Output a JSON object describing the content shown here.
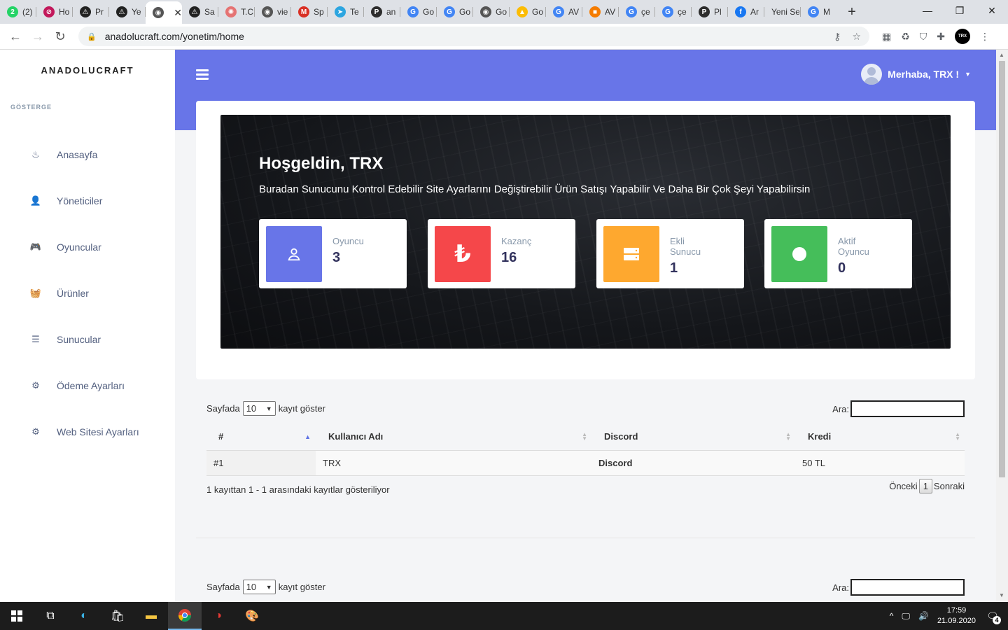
{
  "browser": {
    "tabs": [
      {
        "label": "(2)",
        "icon": "whatsapp-icon",
        "color": "#25d366",
        "glyph": "2"
      },
      {
        "label": "Ho",
        "icon": "site-icon",
        "color": "#c2185b",
        "glyph": "⊘"
      },
      {
        "label": "Pr",
        "icon": "triangle-logo-icon",
        "color": "#222222",
        "glyph": "⚠"
      },
      {
        "label": "Ye",
        "icon": "triangle-logo-icon",
        "color": "#222222",
        "glyph": "⚠"
      },
      {
        "label": "",
        "icon": "globe-icon",
        "color": "#555555",
        "glyph": "◉",
        "active": true
      },
      {
        "label": "Sa",
        "icon": "triangle-logo-icon",
        "color": "#222222",
        "glyph": "⚠"
      },
      {
        "label": "T.C",
        "icon": "government-seal-icon",
        "color": "#e57373",
        "glyph": "✺"
      },
      {
        "label": "vie",
        "icon": "globe-icon",
        "color": "#555555",
        "glyph": "◉"
      },
      {
        "label": "Sp",
        "icon": "gmail-icon",
        "color": "#d93025",
        "glyph": "M"
      },
      {
        "label": "Te",
        "icon": "telegram-icon",
        "color": "#2ca5e0",
        "glyph": "➤"
      },
      {
        "label": "an",
        "icon": "p-logo-icon",
        "color": "#2d2d2d",
        "glyph": "P"
      },
      {
        "label": "Go",
        "icon": "google-icon",
        "color": "#4285f4",
        "glyph": "G"
      },
      {
        "label": "Go",
        "icon": "google-icon",
        "color": "#4285f4",
        "glyph": "G"
      },
      {
        "label": "Go",
        "icon": "globe-icon",
        "color": "#555555",
        "glyph": "◉"
      },
      {
        "label": "Go",
        "icon": "google-ads-icon",
        "color": "#fbbc04",
        "glyph": "▲"
      },
      {
        "label": "AV",
        "icon": "google-icon",
        "color": "#4285f4",
        "glyph": "G"
      },
      {
        "label": "AV",
        "icon": "cube-icon",
        "color": "#f57c00",
        "glyph": "■"
      },
      {
        "label": "çe",
        "icon": "google-icon",
        "color": "#4285f4",
        "glyph": "G"
      },
      {
        "label": "çe",
        "icon": "google-icon",
        "color": "#4285f4",
        "glyph": "G"
      },
      {
        "label": "Pl",
        "icon": "p-logo-icon",
        "color": "#2d2d2d",
        "glyph": "P"
      },
      {
        "label": "Ar",
        "icon": "facebook-icon",
        "color": "#1877f2",
        "glyph": "f"
      },
      {
        "label": "Yeni Se",
        "icon": "",
        "color": "",
        "glyph": ""
      },
      {
        "label": "M",
        "icon": "google-icon",
        "color": "#4285f4",
        "glyph": "G"
      }
    ],
    "url": "anadolucraft.com/yonetim/home",
    "profile_badge": "TRX"
  },
  "sidebar": {
    "brand": "ANADOLUCRAFT",
    "section": "GÖSTERGE",
    "items": [
      {
        "label": "Anasayfa",
        "icon": "flame-icon",
        "glyph": "♨"
      },
      {
        "label": "Yöneticiler",
        "icon": "user-cog-icon",
        "glyph": "👤"
      },
      {
        "label": "Oyuncular",
        "icon": "gamepad-icon",
        "glyph": "🎮"
      },
      {
        "label": "Ürünler",
        "icon": "basket-icon",
        "glyph": "🧺"
      },
      {
        "label": "Sunucular",
        "icon": "server-icon",
        "glyph": "☰"
      },
      {
        "label": "Ödeme Ayarları",
        "icon": "money-settings-icon",
        "glyph": "⚙"
      },
      {
        "label": "Web Sitesi Ayarları",
        "icon": "cogs-icon",
        "glyph": "⚙"
      }
    ]
  },
  "header": {
    "greeting": "Merhaba, TRX !"
  },
  "hero": {
    "title": "Hoşgeldin, TRX",
    "subtitle": "Buradan Sunucunu Kontrol Edebilir Site Ayarlarını Değiştirebilir Ürün Satışı Yapabilir Ve Daha Bir Çok Şeyi Yapabilirsin"
  },
  "stats": [
    {
      "label": "Oyuncu",
      "value": "3",
      "color": "#6875e8",
      "icon": "user-icon"
    },
    {
      "label": "Kazanç",
      "value": "16",
      "color": "#f5474a",
      "icon": "lira-icon"
    },
    {
      "label": "Ekli Sunucu",
      "value": "1",
      "color": "#fea82f",
      "icon": "server-icon"
    },
    {
      "label": "Aktif Oyuncu",
      "value": "0",
      "color": "#45be5a",
      "icon": "circle-icon"
    }
  ],
  "table": {
    "length_prefix": "Sayfada",
    "length_value": "10",
    "length_suffix": "kayıt göster",
    "search_label": "Ara:",
    "columns": [
      "#",
      "Kullanıcı Adı",
      "Discord",
      "Kredi"
    ],
    "rows": [
      [
        "#1",
        "TRX",
        "Discord",
        "50 TL"
      ]
    ],
    "info": "1 kayıttan 1 - 1 arasındaki kayıtlar gösteriliyor",
    "prev": "Önceki",
    "page": "1",
    "next": "Sonraki"
  },
  "taskbar": {
    "time": "17:59",
    "date": "21.09.2020",
    "notifications": "4"
  }
}
